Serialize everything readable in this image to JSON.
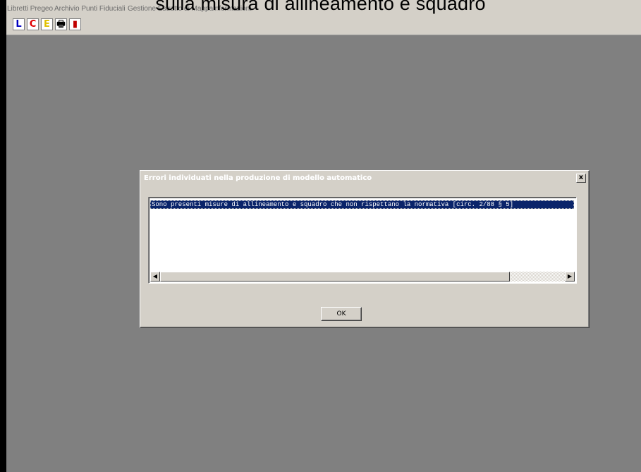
{
  "caption": "sulla misura di allineamento e squadro",
  "menu": {
    "items": [
      {
        "label": "Libretti Pregeo"
      },
      {
        "label": "Archivio Punti Fiduciali"
      },
      {
        "label": "Gestione Estratto di Mappa"
      },
      {
        "label": "Informazioni"
      }
    ]
  },
  "toolbar": {
    "buttons": [
      {
        "icon": "l-letter-icon",
        "glyph": "L",
        "color": "#0000c0"
      },
      {
        "icon": "c-letter-icon",
        "glyph": "C",
        "color": "#e00000"
      },
      {
        "icon": "e-letter-icon",
        "glyph": "E",
        "color": "#e0c000"
      },
      {
        "icon": "printer-icon",
        "glyph": "🖶",
        "color": "#000000"
      },
      {
        "icon": "exit-door-icon",
        "glyph": "▮",
        "color": "#c00000"
      }
    ]
  },
  "dialog": {
    "title": "Errori individuati nella produzione di modello automatico",
    "close_glyph": "x",
    "list_items": [
      "Sono presenti misure di allineamento e squadro che non rispettano la normativa [circ. 2/88 § 5]"
    ],
    "scroll_left_glyph": "◀",
    "scroll_right_glyph": "▶",
    "ok_label": "OK"
  },
  "colors": {
    "desktop": "#808080",
    "face": "#d4d0c8",
    "selection": "#0a246a"
  }
}
